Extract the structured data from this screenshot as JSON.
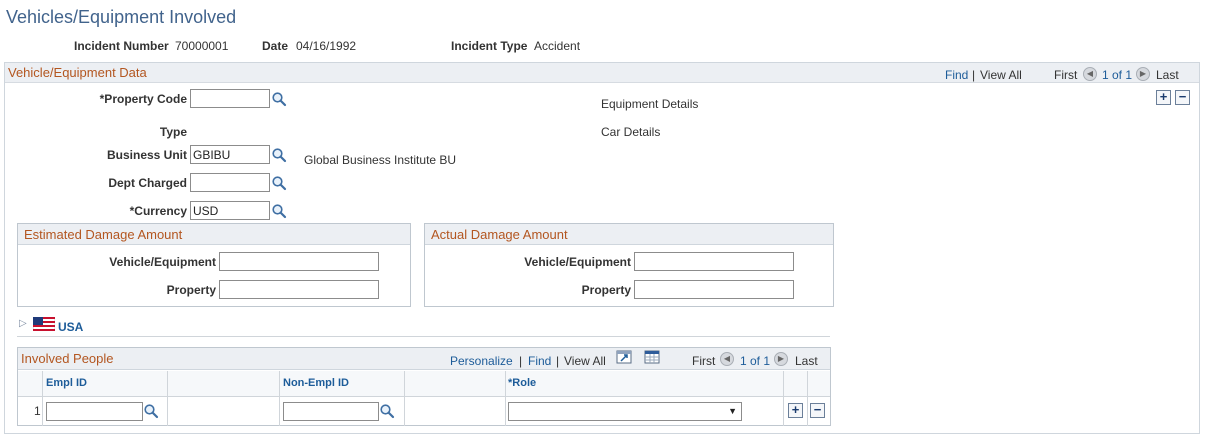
{
  "page": {
    "title": "Vehicles/Equipment Involved"
  },
  "header": {
    "incident_number_label": "Incident Number",
    "incident_number_value": "70000001",
    "date_label": "Date",
    "date_value": "04/16/1992",
    "incident_type_label": "Incident Type",
    "incident_type_value": "Accident"
  },
  "vehicle_panel": {
    "title": "Vehicle/Equipment Data",
    "find": "Find",
    "view_all": "View All",
    "first": "First",
    "count": "1 of 1",
    "last": "Last",
    "separator": "|",
    "property_code_label": "*Property Code",
    "property_code_value": "",
    "type_label": "Type",
    "business_unit_label": "Business Unit",
    "business_unit_value": "GBIBU",
    "business_unit_desc": "Global Business Institute BU",
    "dept_charged_label": "Dept Charged",
    "dept_charged_value": "",
    "currency_label": "*Currency",
    "currency_value": "USD",
    "equipment_details_link": "Equipment Details",
    "car_details_link": "Car Details",
    "add_symbol": "+",
    "remove_symbol": "−"
  },
  "estimated_damage": {
    "title": "Estimated Damage Amount",
    "vehicle_label": "Vehicle/Equipment",
    "vehicle_value": "",
    "property_label": "Property",
    "property_value": ""
  },
  "actual_damage": {
    "title": "Actual Damage Amount",
    "vehicle_label": "Vehicle/Equipment",
    "vehicle_value": "",
    "property_label": "Property",
    "property_value": ""
  },
  "country": {
    "label": "USA",
    "expand_symbol": "▷"
  },
  "involved_people": {
    "title": "Involved People",
    "personalize": "Personalize",
    "find": "Find",
    "view_all": "View All",
    "separator": "|",
    "first": "First",
    "count": "1 of 1",
    "last": "Last",
    "columns": [
      "Empl ID",
      "Non-Empl ID",
      "*Role"
    ],
    "rows": [
      {
        "row_number": "1",
        "empl_id": "",
        "non_empl_id": "",
        "role": ""
      }
    ],
    "add_symbol": "+",
    "remove_symbol": "−"
  },
  "colors": {
    "section_title": "#b35620",
    "link": "#1d5c99",
    "page_title": "#41638c",
    "panel_header_bg": "#eceff3"
  }
}
